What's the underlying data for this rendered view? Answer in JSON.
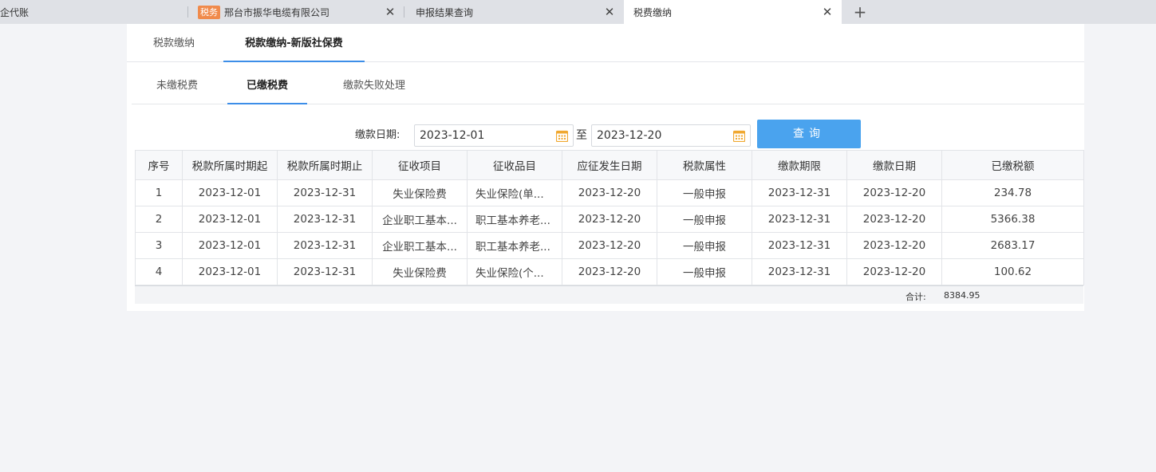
{
  "browser": {
    "tabs": [
      {
        "title": "记企代账"
      },
      {
        "badge": "税务",
        "title": "邢台市振华电缆有限公司"
      },
      {
        "title": "申报结果查询"
      },
      {
        "title": "税费缴纳"
      }
    ],
    "close_glyph": "✕",
    "new_tab_glyph": "+"
  },
  "top_tabs": {
    "t1": "税款缴纳",
    "t2": "税款缴纳-新版社保费"
  },
  "sub_tabs": {
    "s1": "未缴税费",
    "s2": "已缴税费",
    "s3": "缴款失败处理"
  },
  "filter": {
    "label": "缴款日期:",
    "start": "2023-12-01",
    "separator": "至",
    "end": "2023-12-20",
    "query_label": "查询"
  },
  "table": {
    "headers": [
      "序号",
      "税款所属时期起",
      "税款所属时期止",
      "征收项目",
      "征收品目",
      "应征发生日期",
      "税款属性",
      "缴款期限",
      "缴款日期",
      "已缴税额"
    ],
    "rows": [
      [
        "1",
        "2023-12-01",
        "2023-12-31",
        "失业保险费",
        "失业保险(单...",
        "2023-12-20",
        "一般申报",
        "2023-12-31",
        "2023-12-20",
        "234.78"
      ],
      [
        "2",
        "2023-12-01",
        "2023-12-31",
        "企业职工基本...",
        "职工基本养老...",
        "2023-12-20",
        "一般申报",
        "2023-12-31",
        "2023-12-20",
        "5366.38"
      ],
      [
        "3",
        "2023-12-01",
        "2023-12-31",
        "企业职工基本...",
        "职工基本养老...",
        "2023-12-20",
        "一般申报",
        "2023-12-31",
        "2023-12-20",
        "2683.17"
      ],
      [
        "4",
        "2023-12-01",
        "2023-12-31",
        "失业保险费",
        "失业保险(个...",
        "2023-12-20",
        "一般申报",
        "2023-12-31",
        "2023-12-20",
        "100.62"
      ]
    ]
  },
  "totals": {
    "label": "合计:",
    "value": "8384.95"
  },
  "icons": {
    "calendar": "calendar-icon",
    "close": "close-icon",
    "new_tab": "plus-icon"
  },
  "colors": {
    "accent": "#3d8ee8",
    "button": "#4aa3ee",
    "badge": "#f08a4b",
    "calendar": "#f0a830"
  }
}
